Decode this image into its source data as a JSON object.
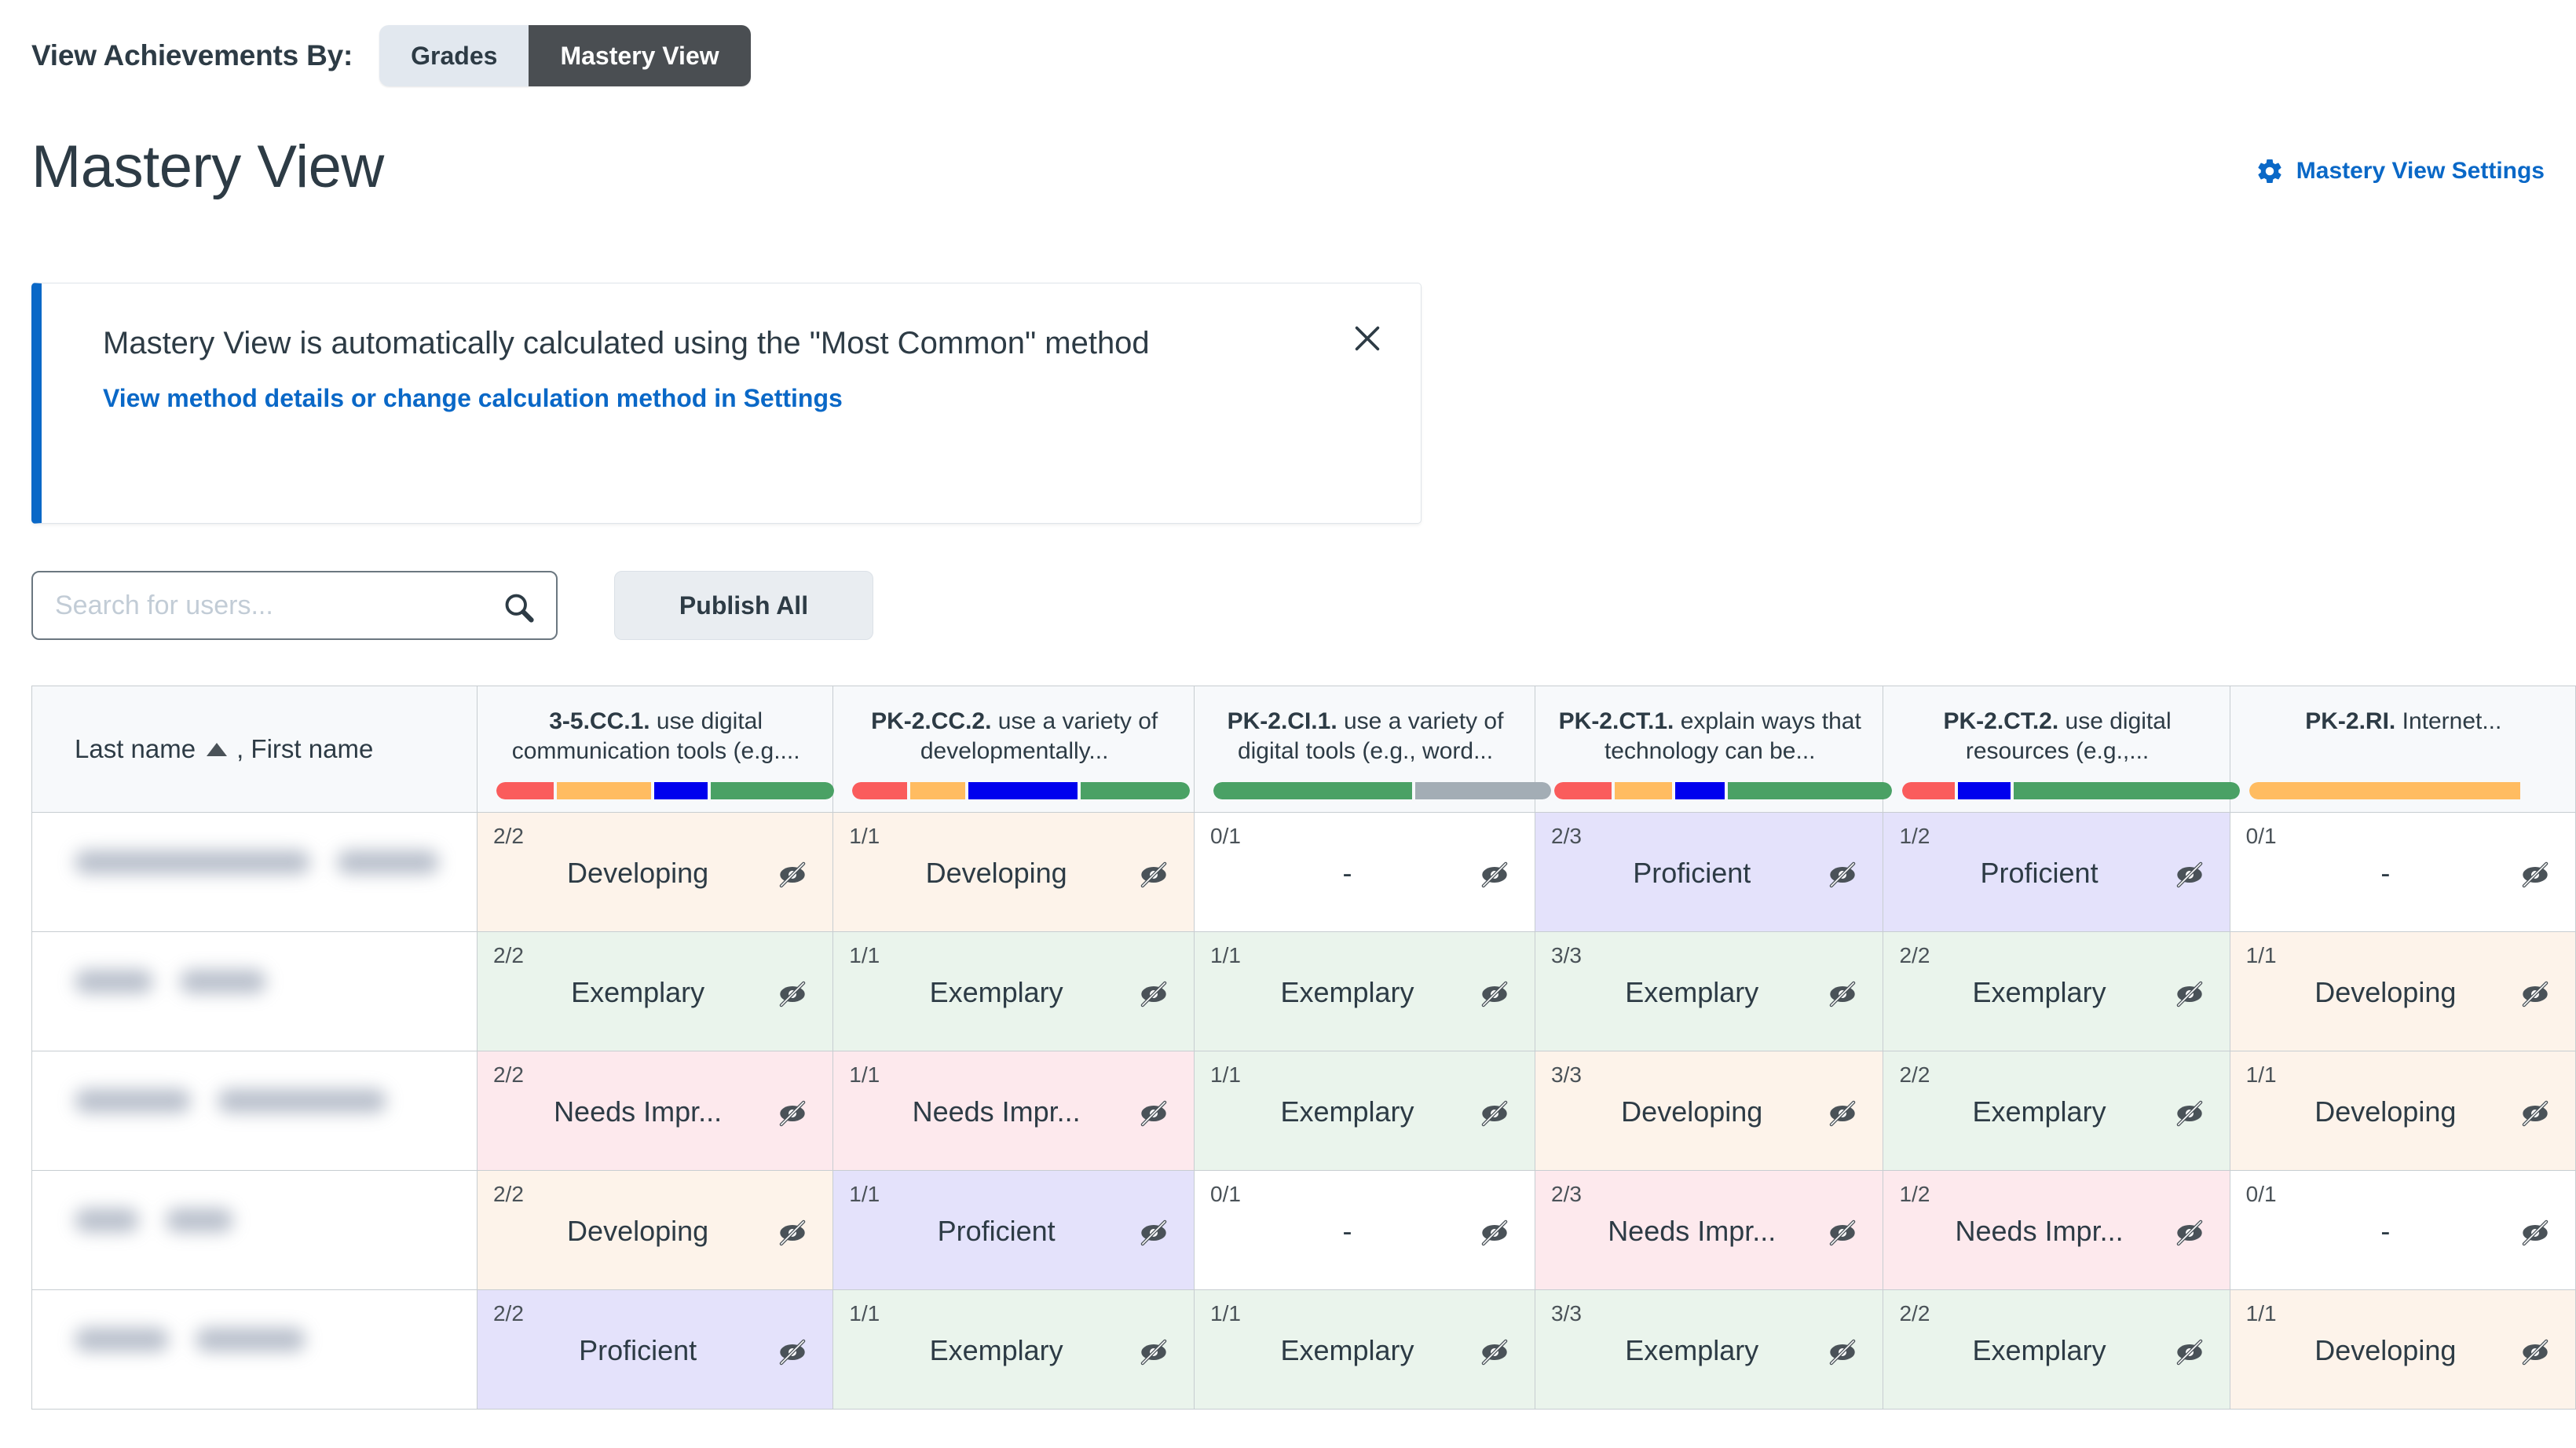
{
  "toggle": {
    "label": "View Achievements By:",
    "options": [
      {
        "label": "Grades",
        "active": false
      },
      {
        "label": "Mastery View",
        "active": true
      }
    ]
  },
  "header": {
    "title": "Mastery View",
    "settings_link": "Mastery View Settings",
    "settings_icon": "gear-icon",
    "accent_color": "#0a68c7"
  },
  "alert": {
    "message": "Mastery View is automatically calculated using the \"Most Common\" method",
    "link": "View method details or change calculation method in Settings",
    "close_icon": "close-icon",
    "border_color": "#0a68c7"
  },
  "search": {
    "placeholder": "Search for users...",
    "value": "",
    "icon": "search-icon"
  },
  "publish_button": {
    "label": "Publish All"
  },
  "table": {
    "name_column": {
      "last_name_label": "Last name",
      "sort_icon": "sort-ascending-caret",
      "first_name_label": ", First name"
    },
    "rating_colors": {
      "needs_improvement": "#fa5c5c",
      "developing": "#ffbc61",
      "proficient": "#0000ee",
      "exemplary": "#4aa165",
      "no_evidence": "#a3adb5"
    },
    "cell_colors": {
      "developing": "#fdf3ea",
      "exemplary": "#eaf4ec",
      "proficient": "#e4e2fb",
      "needs_improvement": "#fde9ed",
      "none": "#ffffff"
    },
    "columns": [
      {
        "code": "3-5.CC.1.",
        "description": "use digital communication tools (e.g....",
        "bar": [
          {
            "color": "#fa5c5c",
            "weight": 14
          },
          {
            "color": "#ffbc61",
            "weight": 23
          },
          {
            "color": "#0000ee",
            "weight": 13
          },
          {
            "color": "#4aa165",
            "weight": 30
          }
        ]
      },
      {
        "code": "PK-2.CC.2.",
        "description": "use a variety of developmentally...",
        "bar": [
          {
            "color": "#fa5c5c",
            "weight": 13
          },
          {
            "color": "#ffbc61",
            "weight": 13
          },
          {
            "color": "#0000ee",
            "weight": 26
          },
          {
            "color": "#4aa165",
            "weight": 26
          }
        ]
      },
      {
        "code": "PK-2.CI.1.",
        "description": "use a variety of digital tools (e.g., word...",
        "bar": [
          {
            "color": "#4aa165",
            "weight": 44
          },
          {
            "color": "#a3adb5",
            "weight": 30
          }
        ]
      },
      {
        "code": "PK-2.CT.1.",
        "description": "explain ways that technology can be...",
        "bar": [
          {
            "color": "#fa5c5c",
            "weight": 14
          },
          {
            "color": "#ffbc61",
            "weight": 14
          },
          {
            "color": "#0000ee",
            "weight": 12
          },
          {
            "color": "#4aa165",
            "weight": 40
          }
        ]
      },
      {
        "code": "PK-2.CT.2.",
        "description": "use digital resources (e.g.,...",
        "bar": [
          {
            "color": "#fa5c5c",
            "weight": 13
          },
          {
            "color": "#0000ee",
            "weight": 13
          },
          {
            "color": "#4aa165",
            "weight": 56
          }
        ]
      },
      {
        "code": "PK-2.RI.",
        "description": "Internet...",
        "bar": [
          {
            "color": "#ffbc61",
            "weight": 60
          }
        ]
      }
    ],
    "eye_icon": "eye-off-icon",
    "rows": [
      {
        "name_redacted": [
          300,
          130
        ],
        "cells": [
          {
            "fraction": "2/2",
            "label": "Developing",
            "status": "developing"
          },
          {
            "fraction": "1/1",
            "label": "Developing",
            "status": "developing"
          },
          {
            "fraction": "0/1",
            "label": "-",
            "status": "none"
          },
          {
            "fraction": "2/3",
            "label": "Proficient",
            "status": "proficient"
          },
          {
            "fraction": "1/2",
            "label": "Proficient",
            "status": "proficient"
          },
          {
            "fraction": "0/1",
            "label": "-",
            "status": "none"
          }
        ]
      },
      {
        "name_redacted": [
          100,
          110
        ],
        "cells": [
          {
            "fraction": "2/2",
            "label": "Exemplary",
            "status": "exemplary"
          },
          {
            "fraction": "1/1",
            "label": "Exemplary",
            "status": "exemplary"
          },
          {
            "fraction": "1/1",
            "label": "Exemplary",
            "status": "exemplary"
          },
          {
            "fraction": "3/3",
            "label": "Exemplary",
            "status": "exemplary"
          },
          {
            "fraction": "2/2",
            "label": "Exemplary",
            "status": "exemplary"
          },
          {
            "fraction": "1/1",
            "label": "Developing",
            "status": "developing"
          }
        ]
      },
      {
        "name_redacted": [
          148,
          215
        ],
        "cells": [
          {
            "fraction": "2/2",
            "label": "Needs Impr...",
            "status": "needs_improvement"
          },
          {
            "fraction": "1/1",
            "label": "Needs Impr...",
            "status": "needs_improvement"
          },
          {
            "fraction": "1/1",
            "label": "Exemplary",
            "status": "exemplary"
          },
          {
            "fraction": "3/3",
            "label": "Developing",
            "status": "developing"
          },
          {
            "fraction": "2/2",
            "label": "Exemplary",
            "status": "exemplary"
          },
          {
            "fraction": "1/1",
            "label": "Developing",
            "status": "developing"
          }
        ]
      },
      {
        "name_redacted": [
          82,
          86
        ],
        "cells": [
          {
            "fraction": "2/2",
            "label": "Developing",
            "status": "developing"
          },
          {
            "fraction": "1/1",
            "label": "Proficient",
            "status": "proficient"
          },
          {
            "fraction": "0/1",
            "label": "-",
            "status": "none"
          },
          {
            "fraction": "2/3",
            "label": "Needs Impr...",
            "status": "needs_improvement"
          },
          {
            "fraction": "1/2",
            "label": "Needs Impr...",
            "status": "needs_improvement"
          },
          {
            "fraction": "0/1",
            "label": "-",
            "status": "none"
          }
        ]
      },
      {
        "name_redacted": [
          120,
          140
        ],
        "cells": [
          {
            "fraction": "2/2",
            "label": "Proficient",
            "status": "proficient"
          },
          {
            "fraction": "1/1",
            "label": "Exemplary",
            "status": "exemplary"
          },
          {
            "fraction": "1/1",
            "label": "Exemplary",
            "status": "exemplary"
          },
          {
            "fraction": "3/3",
            "label": "Exemplary",
            "status": "exemplary"
          },
          {
            "fraction": "2/2",
            "label": "Exemplary",
            "status": "exemplary"
          },
          {
            "fraction": "1/1",
            "label": "Developing",
            "status": "developing"
          }
        ]
      }
    ]
  }
}
